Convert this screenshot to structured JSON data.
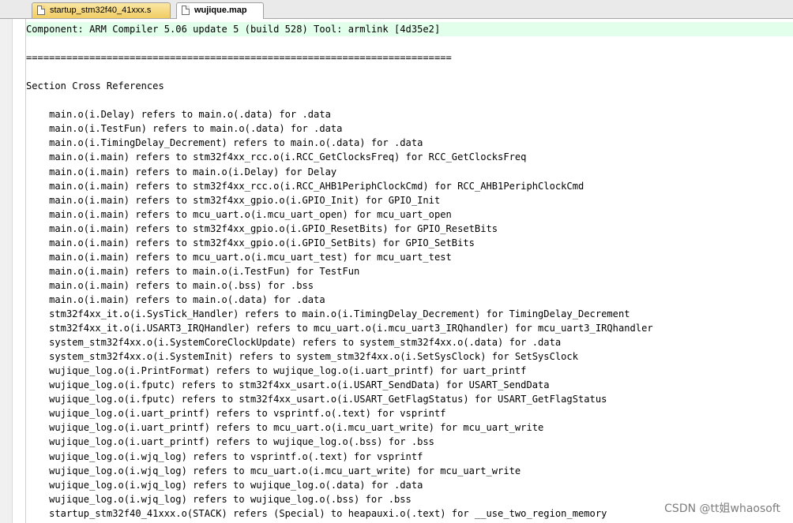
{
  "tabs": [
    {
      "label": "startup_stm32f40_41xxx.s",
      "active": false
    },
    {
      "label": "wujique.map",
      "active": true
    }
  ],
  "lines": [
    "Component: ARM Compiler 5.06 update 5 (build 528) Tool: armlink [4d35e2]",
    "",
    "==========================================================================",
    "",
    "Section Cross References",
    "",
    "    main.o(i.Delay) refers to main.o(.data) for .data",
    "    main.o(i.TestFun) refers to main.o(.data) for .data",
    "    main.o(i.TimingDelay_Decrement) refers to main.o(.data) for .data",
    "    main.o(i.main) refers to stm32f4xx_rcc.o(i.RCC_GetClocksFreq) for RCC_GetClocksFreq",
    "    main.o(i.main) refers to main.o(i.Delay) for Delay",
    "    main.o(i.main) refers to stm32f4xx_rcc.o(i.RCC_AHB1PeriphClockCmd) for RCC_AHB1PeriphClockCmd",
    "    main.o(i.main) refers to stm32f4xx_gpio.o(i.GPIO_Init) for GPIO_Init",
    "    main.o(i.main) refers to mcu_uart.o(i.mcu_uart_open) for mcu_uart_open",
    "    main.o(i.main) refers to stm32f4xx_gpio.o(i.GPIO_ResetBits) for GPIO_ResetBits",
    "    main.o(i.main) refers to stm32f4xx_gpio.o(i.GPIO_SetBits) for GPIO_SetBits",
    "    main.o(i.main) refers to mcu_uart.o(i.mcu_uart_test) for mcu_uart_test",
    "    main.o(i.main) refers to main.o(i.TestFun) for TestFun",
    "    main.o(i.main) refers to main.o(.bss) for .bss",
    "    main.o(i.main) refers to main.o(.data) for .data",
    "    stm32f4xx_it.o(i.SysTick_Handler) refers to main.o(i.TimingDelay_Decrement) for TimingDelay_Decrement",
    "    stm32f4xx_it.o(i.USART3_IRQHandler) refers to mcu_uart.o(i.mcu_uart3_IRQhandler) for mcu_uart3_IRQhandler",
    "    system_stm32f4xx.o(i.SystemCoreClockUpdate) refers to system_stm32f4xx.o(.data) for .data",
    "    system_stm32f4xx.o(i.SystemInit) refers to system_stm32f4xx.o(i.SetSysClock) for SetSysClock",
    "    wujique_log.o(i.PrintFormat) refers to wujique_log.o(i.uart_printf) for uart_printf",
    "    wujique_log.o(i.fputc) refers to stm32f4xx_usart.o(i.USART_SendData) for USART_SendData",
    "    wujique_log.o(i.fputc) refers to stm32f4xx_usart.o(i.USART_GetFlagStatus) for USART_GetFlagStatus",
    "    wujique_log.o(i.uart_printf) refers to vsprintf.o(.text) for vsprintf",
    "    wujique_log.o(i.uart_printf) refers to mcu_uart.o(i.mcu_uart_write) for mcu_uart_write",
    "    wujique_log.o(i.uart_printf) refers to wujique_log.o(.bss) for .bss",
    "    wujique_log.o(i.wjq_log) refers to vsprintf.o(.text) for vsprintf",
    "    wujique_log.o(i.wjq_log) refers to mcu_uart.o(i.mcu_uart_write) for mcu_uart_write",
    "    wujique_log.o(i.wjq_log) refers to wujique_log.o(.data) for .data",
    "    wujique_log.o(i.wjq_log) refers to wujique_log.o(.bss) for .bss",
    "    startup_stm32f40_41xxx.o(STACK) refers (Special) to heapauxi.o(.text) for __use_two_region_memory"
  ],
  "watermark": "CSDN @tt姐whaosoft"
}
